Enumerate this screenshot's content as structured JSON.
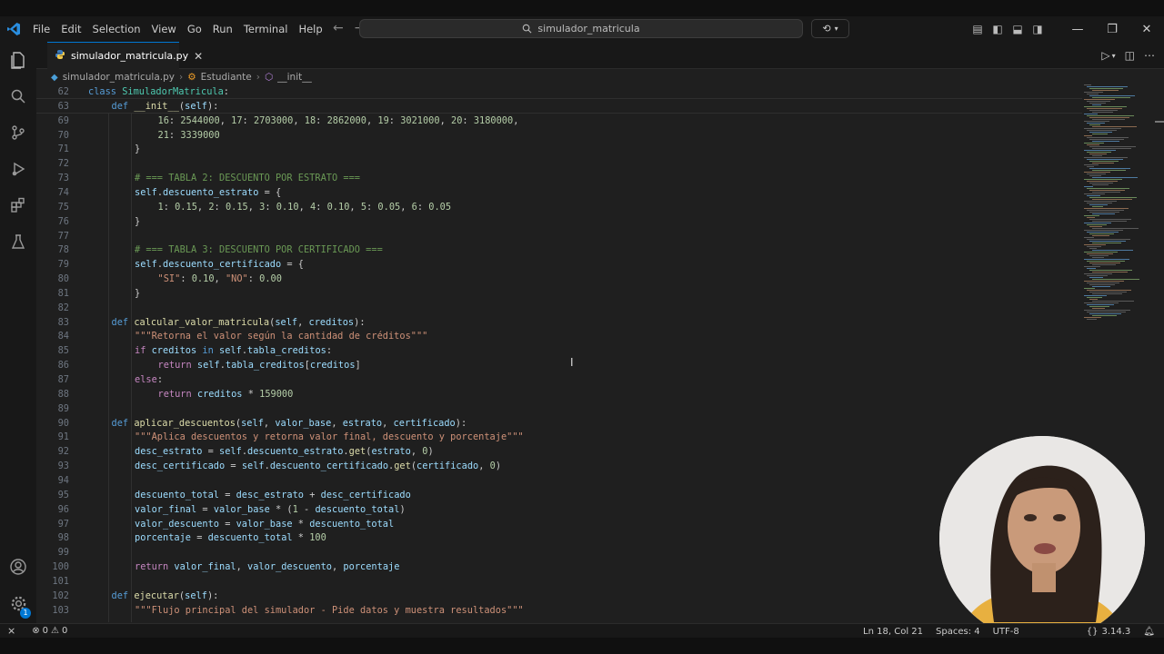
{
  "menu": [
    "File",
    "Edit",
    "Selection",
    "View",
    "Go",
    "Run",
    "Terminal",
    "Help"
  ],
  "search": {
    "text": "simulador_matricula"
  },
  "tab": {
    "label": "simulador_matricula.py"
  },
  "breadcrumb": {
    "file": "simulador_matricula.py",
    "class": "Estudiante",
    "method": "__init__"
  },
  "status": {
    "errors": "0",
    "warnings": "0",
    "position": "Ln 18, Col 21",
    "spaces": "Spaces: 4",
    "encoding": "UTF-8",
    "python_version": "3.14.3"
  },
  "badge": "1",
  "code_lines": [
    {
      "n": "62",
      "indent": 0,
      "sticky": true,
      "tokens": [
        [
          "kw",
          "class "
        ],
        [
          "cls",
          "SimuladorMatricula"
        ],
        [
          "p",
          ":"
        ]
      ]
    },
    {
      "n": "63",
      "indent": 1,
      "sticky": true,
      "tokens": [
        [
          "kw",
          "def "
        ],
        [
          "fn",
          "__init__"
        ],
        [
          "p",
          "("
        ],
        [
          "sf",
          "self"
        ],
        [
          "p",
          "):"
        ]
      ]
    },
    {
      "n": "69",
      "indent": 3,
      "tokens": [
        [
          "num",
          "16"
        ],
        [
          "p",
          ": "
        ],
        [
          "num",
          "2544000"
        ],
        [
          "p",
          ", "
        ],
        [
          "num",
          "17"
        ],
        [
          "p",
          ": "
        ],
        [
          "num",
          "2703000"
        ],
        [
          "p",
          ", "
        ],
        [
          "num",
          "18"
        ],
        [
          "p",
          ": "
        ],
        [
          "num",
          "2862000"
        ],
        [
          "p",
          ", "
        ],
        [
          "num",
          "19"
        ],
        [
          "p",
          ": "
        ],
        [
          "num",
          "3021000"
        ],
        [
          "p",
          ", "
        ],
        [
          "num",
          "20"
        ],
        [
          "p",
          ": "
        ],
        [
          "num",
          "3180000"
        ],
        [
          "p",
          ","
        ]
      ]
    },
    {
      "n": "70",
      "indent": 3,
      "tokens": [
        [
          "num",
          "21"
        ],
        [
          "p",
          ": "
        ],
        [
          "num",
          "3339000"
        ]
      ]
    },
    {
      "n": "71",
      "indent": 2,
      "tokens": [
        [
          "p",
          "}"
        ]
      ]
    },
    {
      "n": "72",
      "indent": 0,
      "tokens": []
    },
    {
      "n": "73",
      "indent": 2,
      "tokens": [
        [
          "com",
          "# === TABLA 2: DESCUENTO POR ESTRATO ==="
        ]
      ]
    },
    {
      "n": "74",
      "indent": 2,
      "tokens": [
        [
          "sf",
          "self"
        ],
        [
          "p",
          "."
        ],
        [
          "sf",
          "descuento_estrato"
        ],
        [
          "p",
          " = {"
        ]
      ]
    },
    {
      "n": "75",
      "indent": 3,
      "tokens": [
        [
          "num",
          "1"
        ],
        [
          "p",
          ": "
        ],
        [
          "num",
          "0.15"
        ],
        [
          "p",
          ", "
        ],
        [
          "num",
          "2"
        ],
        [
          "p",
          ": "
        ],
        [
          "num",
          "0.15"
        ],
        [
          "p",
          ", "
        ],
        [
          "num",
          "3"
        ],
        [
          "p",
          ": "
        ],
        [
          "num",
          "0.10"
        ],
        [
          "p",
          ", "
        ],
        [
          "num",
          "4"
        ],
        [
          "p",
          ": "
        ],
        [
          "num",
          "0.10"
        ],
        [
          "p",
          ", "
        ],
        [
          "num",
          "5"
        ],
        [
          "p",
          ": "
        ],
        [
          "num",
          "0.05"
        ],
        [
          "p",
          ", "
        ],
        [
          "num",
          "6"
        ],
        [
          "p",
          ": "
        ],
        [
          "num",
          "0.05"
        ]
      ]
    },
    {
      "n": "76",
      "indent": 2,
      "tokens": [
        [
          "p",
          "}"
        ]
      ]
    },
    {
      "n": "77",
      "indent": 0,
      "tokens": []
    },
    {
      "n": "78",
      "indent": 2,
      "tokens": [
        [
          "com",
          "# === TABLA 3: DESCUENTO POR CERTIFICADO ==="
        ]
      ]
    },
    {
      "n": "79",
      "indent": 2,
      "tokens": [
        [
          "sf",
          "self"
        ],
        [
          "p",
          "."
        ],
        [
          "sf",
          "descuento_certificado"
        ],
        [
          "p",
          " = {"
        ]
      ]
    },
    {
      "n": "80",
      "indent": 3,
      "tokens": [
        [
          "str",
          "\"SI\""
        ],
        [
          "p",
          ": "
        ],
        [
          "num",
          "0.10"
        ],
        [
          "p",
          ", "
        ],
        [
          "str",
          "\"NO\""
        ],
        [
          "p",
          ": "
        ],
        [
          "num",
          "0.00"
        ]
      ]
    },
    {
      "n": "81",
      "indent": 2,
      "tokens": [
        [
          "p",
          "}"
        ]
      ]
    },
    {
      "n": "82",
      "indent": 0,
      "tokens": []
    },
    {
      "n": "83",
      "indent": 1,
      "tokens": [
        [
          "kw",
          "def "
        ],
        [
          "fn",
          "calcular_valor_matricula"
        ],
        [
          "p",
          "("
        ],
        [
          "sf",
          "self"
        ],
        [
          "p",
          ", "
        ],
        [
          "sf",
          "creditos"
        ],
        [
          "p",
          "):"
        ]
      ]
    },
    {
      "n": "84",
      "indent": 2,
      "tokens": [
        [
          "str",
          "\"\"\"Retorna el valor según la cantidad de créditos\"\"\""
        ]
      ]
    },
    {
      "n": "85",
      "indent": 2,
      "tokens": [
        [
          "kw2",
          "if "
        ],
        [
          "sf",
          "creditos"
        ],
        [
          "kw",
          " in "
        ],
        [
          "sf",
          "self"
        ],
        [
          "p",
          "."
        ],
        [
          "sf",
          "tabla_creditos"
        ],
        [
          "p",
          ":"
        ]
      ]
    },
    {
      "n": "86",
      "indent": 3,
      "tokens": [
        [
          "kw2",
          "return "
        ],
        [
          "sf",
          "self"
        ],
        [
          "p",
          "."
        ],
        [
          "sf",
          "tabla_creditos"
        ],
        [
          "p",
          "["
        ],
        [
          "sf",
          "creditos"
        ],
        [
          "p",
          "]"
        ]
      ]
    },
    {
      "n": "87",
      "indent": 2,
      "tokens": [
        [
          "kw2",
          "else"
        ],
        [
          "p",
          ":"
        ]
      ]
    },
    {
      "n": "88",
      "indent": 3,
      "tokens": [
        [
          "kw2",
          "return "
        ],
        [
          "sf",
          "creditos"
        ],
        [
          "p",
          " * "
        ],
        [
          "num",
          "159000"
        ]
      ]
    },
    {
      "n": "89",
      "indent": 0,
      "tokens": []
    },
    {
      "n": "90",
      "indent": 1,
      "tokens": [
        [
          "kw",
          "def "
        ],
        [
          "fn",
          "aplicar_descuentos"
        ],
        [
          "p",
          "("
        ],
        [
          "sf",
          "self"
        ],
        [
          "p",
          ", "
        ],
        [
          "sf",
          "valor_base"
        ],
        [
          "p",
          ", "
        ],
        [
          "sf",
          "estrato"
        ],
        [
          "p",
          ", "
        ],
        [
          "sf",
          "certificado"
        ],
        [
          "p",
          "):"
        ]
      ]
    },
    {
      "n": "91",
      "indent": 2,
      "tokens": [
        [
          "str",
          "\"\"\"Aplica descuentos y retorna valor final, descuento y porcentaje\"\"\""
        ]
      ]
    },
    {
      "n": "92",
      "indent": 2,
      "tokens": [
        [
          "sf",
          "desc_estrato"
        ],
        [
          "p",
          " = "
        ],
        [
          "sf",
          "self"
        ],
        [
          "p",
          "."
        ],
        [
          "sf",
          "descuento_estrato"
        ],
        [
          "p",
          "."
        ],
        [
          "fn",
          "get"
        ],
        [
          "p",
          "("
        ],
        [
          "sf",
          "estrato"
        ],
        [
          "p",
          ", "
        ],
        [
          "num",
          "0"
        ],
        [
          "p",
          ")"
        ]
      ]
    },
    {
      "n": "93",
      "indent": 2,
      "tokens": [
        [
          "sf",
          "desc_certificado"
        ],
        [
          "p",
          " = "
        ],
        [
          "sf",
          "self"
        ],
        [
          "p",
          "."
        ],
        [
          "sf",
          "descuento_certificado"
        ],
        [
          "p",
          "."
        ],
        [
          "fn",
          "get"
        ],
        [
          "p",
          "("
        ],
        [
          "sf",
          "certificado"
        ],
        [
          "p",
          ", "
        ],
        [
          "num",
          "0"
        ],
        [
          "p",
          ")"
        ]
      ]
    },
    {
      "n": "94",
      "indent": 0,
      "tokens": []
    },
    {
      "n": "95",
      "indent": 2,
      "tokens": [
        [
          "sf",
          "descuento_total"
        ],
        [
          "p",
          " = "
        ],
        [
          "sf",
          "desc_estrato"
        ],
        [
          "p",
          " + "
        ],
        [
          "sf",
          "desc_certificado"
        ]
      ]
    },
    {
      "n": "96",
      "indent": 2,
      "tokens": [
        [
          "sf",
          "valor_final"
        ],
        [
          "p",
          " = "
        ],
        [
          "sf",
          "valor_base"
        ],
        [
          "p",
          " * ("
        ],
        [
          "num",
          "1"
        ],
        [
          "p",
          " - "
        ],
        [
          "sf",
          "descuento_total"
        ],
        [
          "p",
          ")"
        ]
      ]
    },
    {
      "n": "97",
      "indent": 2,
      "tokens": [
        [
          "sf",
          "valor_descuento"
        ],
        [
          "p",
          " = "
        ],
        [
          "sf",
          "valor_base"
        ],
        [
          "p",
          " * "
        ],
        [
          "sf",
          "descuento_total"
        ]
      ]
    },
    {
      "n": "98",
      "indent": 2,
      "tokens": [
        [
          "sf",
          "porcentaje"
        ],
        [
          "p",
          " = "
        ],
        [
          "sf",
          "descuento_total"
        ],
        [
          "p",
          " * "
        ],
        [
          "num",
          "100"
        ]
      ]
    },
    {
      "n": "99",
      "indent": 0,
      "tokens": []
    },
    {
      "n": "100",
      "indent": 2,
      "tokens": [
        [
          "kw2",
          "return "
        ],
        [
          "sf",
          "valor_final"
        ],
        [
          "p",
          ", "
        ],
        [
          "sf",
          "valor_descuento"
        ],
        [
          "p",
          ", "
        ],
        [
          "sf",
          "porcentaje"
        ]
      ]
    },
    {
      "n": "101",
      "indent": 0,
      "tokens": []
    },
    {
      "n": "102",
      "indent": 1,
      "tokens": [
        [
          "kw",
          "def "
        ],
        [
          "fn",
          "ejecutar"
        ],
        [
          "p",
          "("
        ],
        [
          "sf",
          "self"
        ],
        [
          "p",
          "):"
        ]
      ]
    },
    {
      "n": "103",
      "indent": 2,
      "tokens": [
        [
          "str",
          "\"\"\"Flujo principal del simulador - Pide datos y muestra resultados\"\"\""
        ]
      ]
    }
  ]
}
